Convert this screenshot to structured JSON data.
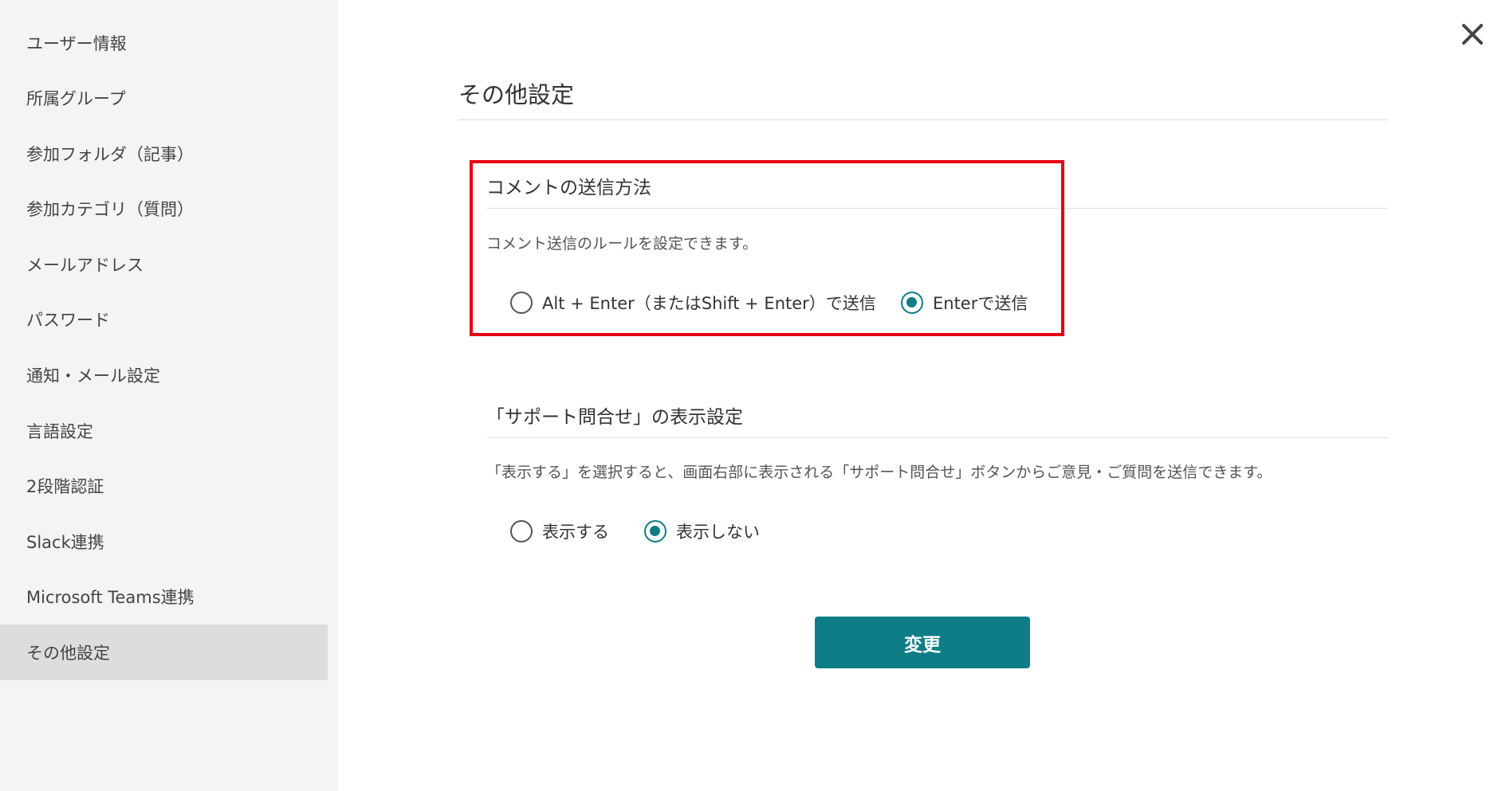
{
  "sidebar": {
    "items": [
      {
        "label": "ユーザー情報"
      },
      {
        "label": "所属グループ"
      },
      {
        "label": "参加フォルダ（記事）"
      },
      {
        "label": "参加カテゴリ（質問）"
      },
      {
        "label": "メールアドレス"
      },
      {
        "label": "パスワード"
      },
      {
        "label": "通知・メール設定"
      },
      {
        "label": "言語設定"
      },
      {
        "label": "2段階認証"
      },
      {
        "label": "Slack連携"
      },
      {
        "label": "Microsoft Teams連携"
      },
      {
        "label": "その他設定"
      }
    ],
    "active_label": "その他設定"
  },
  "close": {
    "icon": "close-icon"
  },
  "main": {
    "title": "その他設定",
    "comment_section": {
      "title": "コメントの送信方法",
      "description": "コメント送信のルールを設定できます。",
      "options": [
        {
          "label": "Alt + Enter（またはShift + Enter）で送信",
          "checked": false
        },
        {
          "label": "Enterで送信",
          "checked": true
        }
      ]
    },
    "support_section": {
      "title": "「サポート問合せ」の表示設定",
      "description": "「表示する」を選択すると、画面右部に表示される「サポート問合せ」ボタンからご意見・ご質問を送信できます。",
      "options": [
        {
          "label": "表示する",
          "checked": false
        },
        {
          "label": "表示しない",
          "checked": true
        }
      ]
    },
    "submit_label": "変更"
  },
  "colors": {
    "accent": "#0e7d86",
    "highlight": "#e60012",
    "sidebar_bg": "#f4f4f4",
    "sidebar_active_bg": "#dddddd"
  }
}
